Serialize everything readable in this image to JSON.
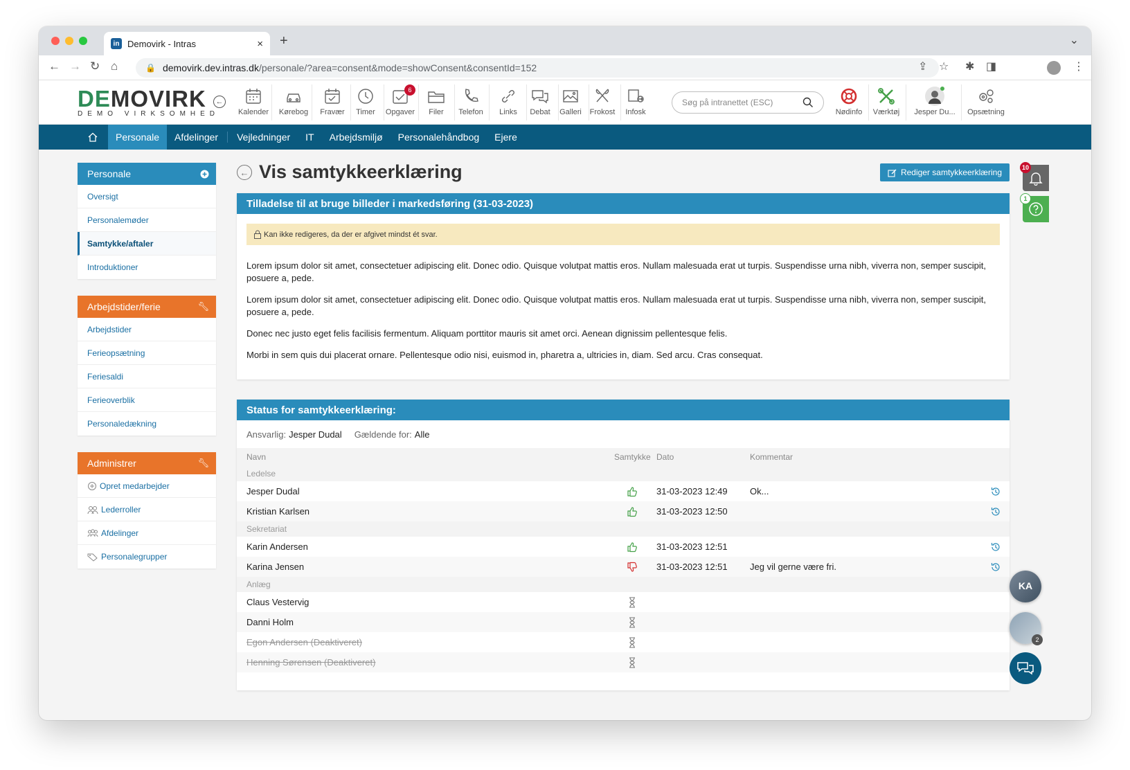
{
  "browser": {
    "tab_title": "Demovirk - Intras",
    "tab_favicon": "in",
    "url_host": "demovirk.dev.intras.dk",
    "url_path": "/personale/?area=consent&mode=showConsent&consentId=152"
  },
  "header": {
    "logo_main": "DEMOVIRK",
    "logo_sub": "DEMO VIRKSOMHED",
    "toolbar": [
      {
        "label": "Kalender",
        "icon": "calendar-icon"
      },
      {
        "label": "Kørebog",
        "icon": "car-icon"
      },
      {
        "label": "Fravær",
        "icon": "calendar-check-icon"
      },
      {
        "label": "Timer",
        "icon": "clock-icon"
      },
      {
        "label": "Opgaver",
        "icon": "tasks-icon",
        "badge": "6"
      },
      {
        "label": "Filer",
        "icon": "folder-icon"
      },
      {
        "label": "Telefon",
        "icon": "phone-icon"
      },
      {
        "label": "Links",
        "icon": "link-icon"
      },
      {
        "label": "Debat",
        "icon": "chat-icon"
      },
      {
        "label": "Galleri",
        "icon": "gallery-icon"
      },
      {
        "label": "Frokost",
        "icon": "cutlery-icon"
      },
      {
        "label": "Infosk",
        "icon": "screen-icon"
      }
    ],
    "search_placeholder": "Søg på intranettet (ESC)",
    "right_tools": [
      {
        "label": "Nødinfo",
        "icon": "lifebuoy-icon"
      },
      {
        "label": "Værktøj",
        "icon": "tools-icon"
      },
      {
        "label": "Jesper Du...",
        "icon": "user-avatar-icon"
      },
      {
        "label": "Opsætning",
        "icon": "gears-icon"
      }
    ]
  },
  "mainnav": {
    "items": [
      "Personale",
      "Afdelinger",
      "Vejledninger",
      "IT",
      "Arbejdsmiljø",
      "Personalehåndbog",
      "Ejere"
    ],
    "active": 0
  },
  "sidebar": {
    "personale": {
      "title": "Personale",
      "items": [
        "Oversigt",
        "Personalemøder",
        "Samtykke/aftaler",
        "Introduktioner"
      ],
      "active": 2
    },
    "arbejdstider": {
      "title": "Arbejdstider/ferie",
      "items": [
        "Arbejdstider",
        "Ferieopsætning",
        "Feriesaldi",
        "Ferieoverblik",
        "Personaledækning"
      ]
    },
    "administrer": {
      "title": "Administrer",
      "items": [
        {
          "label": "Opret medarbejder",
          "icon": "plus-circle-icon"
        },
        {
          "label": "Lederroller",
          "icon": "users-icon"
        },
        {
          "label": "Afdelinger",
          "icon": "group-icon"
        },
        {
          "label": "Personalegrupper",
          "icon": "tag-icon"
        }
      ]
    }
  },
  "page": {
    "title": "Vis samtykkeerklæring",
    "edit_button": "Rediger samtykkeerklæring",
    "consent_title": "Tilladelse til at bruge billeder i markedsføring (31-03-2023)",
    "notice": "Kan ikke redigeres, da der er afgivet mindst ét svar.",
    "paragraphs": [
      "Lorem ipsum dolor sit amet, consectetuer adipiscing elit. Donec odio. Quisque volutpat mattis eros. Nullam malesuada erat ut turpis. Suspendisse urna nibh, viverra non, semper suscipit, posuere a, pede.",
      "Lorem ipsum dolor sit amet, consectetuer adipiscing elit. Donec odio. Quisque volutpat mattis eros. Nullam malesuada erat ut turpis. Suspendisse urna nibh, viverra non, semper suscipit, posuere a, pede.",
      "Donec nec justo eget felis facilisis fermentum. Aliquam porttitor mauris sit amet orci. Aenean dignissim pellentesque felis.",
      "Morbi in sem quis dui placerat ornare. Pellentesque odio nisi, euismod in, pharetra a, ultricies in, diam. Sed arcu. Cras consequat."
    ],
    "status_title": "Status for samtykkeerklæring:",
    "responsible_label": "Ansvarlig:",
    "responsible_value": "Jesper Dudal",
    "applies_label": "Gældende for:",
    "applies_value": "Alle",
    "columns": {
      "name": "Navn",
      "consent": "Samtykke",
      "date": "Dato",
      "comment": "Kommentar"
    }
  },
  "status_rows": [
    {
      "group": "Ledelse"
    },
    {
      "name": "Jesper Dudal",
      "consent": "yes",
      "date": "31-03-2023 12:49",
      "comment": "Ok...",
      "history": true
    },
    {
      "name": "Kristian Karlsen",
      "consent": "yes",
      "date": "31-03-2023 12:50",
      "comment": "",
      "history": true
    },
    {
      "group": "Sekretariat"
    },
    {
      "name": "Karin Andersen",
      "consent": "yes",
      "date": "31-03-2023 12:51",
      "comment": "",
      "history": true
    },
    {
      "name": "Karina Jensen",
      "consent": "no",
      "date": "31-03-2023 12:51",
      "comment": "Jeg vil gerne være fri.",
      "history": true
    },
    {
      "group": "Anlæg"
    },
    {
      "name": "Claus Vestervig",
      "consent": "pending",
      "date": "",
      "comment": ""
    },
    {
      "name": "Danni Holm",
      "consent": "pending",
      "date": "",
      "comment": ""
    },
    {
      "name": "Egon Andersen (Deaktiveret)",
      "consent": "pending",
      "date": "",
      "comment": "",
      "deactivated": true
    },
    {
      "name": "Henning Sørensen (Deaktiveret)",
      "consent": "pending",
      "date": "",
      "comment": "",
      "deactivated": true
    }
  ],
  "floating": {
    "notifications_count": "10",
    "help_count": "1",
    "chat_bubble_initials": "KA",
    "chat_group_count": "2"
  },
  "colors": {
    "primary": "#2a8cbb",
    "nav": "#0a5a7f",
    "orange": "#e8742a",
    "green": "#4caf50",
    "red": "#c8102e"
  }
}
